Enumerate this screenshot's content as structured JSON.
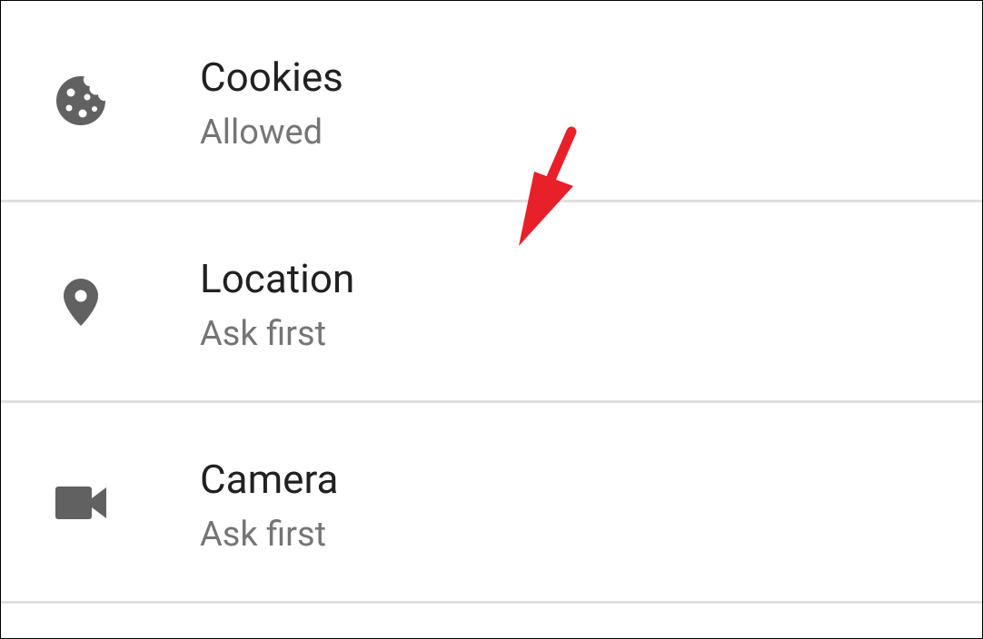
{
  "colors": {
    "title": "#212121",
    "subtitle": "#757575",
    "icon": "#616161",
    "divider": "#e0e0e0",
    "arrow": "#e8202a"
  },
  "settings": [
    {
      "title": "Cookies",
      "status": "Allowed",
      "icon": "cookie-icon"
    },
    {
      "title": "Location",
      "status": "Ask first",
      "icon": "location-pin-icon"
    },
    {
      "title": "Camera",
      "status": "Ask first",
      "icon": "videocam-icon"
    }
  ],
  "annotation": {
    "type": "arrow",
    "points_to": "location-row"
  }
}
